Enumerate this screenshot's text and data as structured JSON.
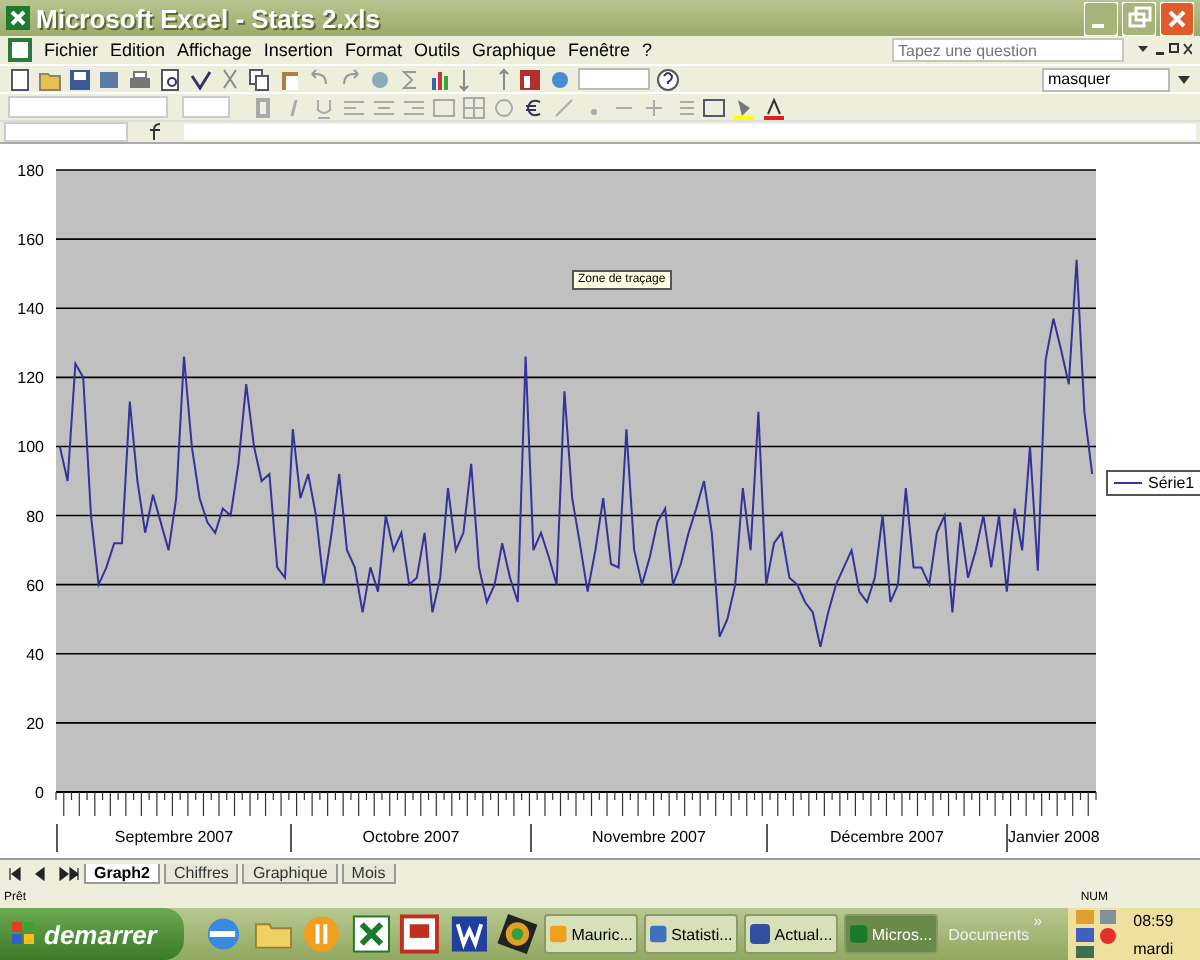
{
  "window": {
    "title": "Microsoft Excel - Stats 2.xls"
  },
  "menu": [
    "Fichier",
    "Edition",
    "Affichage",
    "Insertion",
    "Format",
    "Outils",
    "Graphique",
    "Fenêtre",
    "?"
  ],
  "question_box": {
    "placeholder": "Tapez une question"
  },
  "combo": {
    "value": "masquer"
  },
  "chart": {
    "tooltip": "Zone de traçage",
    "month_labels": [
      "Septembre 2007",
      "Octobre 2007",
      "Novembre 2007",
      "Décembre 2007",
      "Janvier 2008"
    ],
    "chart_data": {
      "type": "line",
      "grid": true,
      "ylim": [
        0,
        180
      ],
      "yticks": [
        0,
        20,
        40,
        60,
        80,
        100,
        120,
        140,
        160,
        180
      ],
      "series": [
        {
          "name": "Série1",
          "color": "#333399",
          "values": [
            100,
            90,
            124,
            120,
            80,
            60,
            65,
            72,
            72,
            113,
            90,
            75,
            86,
            78,
            70,
            85,
            126,
            100,
            85,
            78,
            75,
            82,
            80,
            95,
            118,
            100,
            90,
            92,
            65,
            62,
            105,
            85,
            92,
            80,
            60,
            75,
            92,
            70,
            65,
            52,
            65,
            58,
            80,
            70,
            75,
            60,
            62,
            75,
            52,
            62,
            88,
            70,
            75,
            95,
            65,
            55,
            60,
            72,
            62,
            55,
            126,
            70,
            75,
            68,
            60,
            116,
            85,
            72,
            58,
            70,
            85,
            66,
            65,
            105,
            70,
            60,
            68,
            78,
            82,
            60,
            66,
            75,
            82,
            90,
            75,
            45,
            50,
            60,
            88,
            70,
            110,
            60,
            72,
            75,
            62,
            60,
            55,
            52,
            42,
            52,
            60,
            65,
            70,
            58,
            55,
            62,
            80,
            55,
            60,
            88,
            65,
            65,
            60,
            75,
            80,
            52,
            78,
            62,
            70,
            80,
            65,
            80,
            58,
            82,
            70,
            100,
            64,
            125,
            137,
            128,
            118,
            154,
            110,
            92
          ]
        }
      ]
    }
  },
  "sheet_tabs": [
    {
      "label": "Graph2",
      "selected": true
    },
    {
      "label": "Chiffres",
      "selected": false
    },
    {
      "label": "Graphique",
      "selected": false
    },
    {
      "label": "Mois",
      "selected": false
    }
  ],
  "status_bar": {
    "left": "Prêt",
    "right": "NUM"
  },
  "taskbar": {
    "start": "demarrer",
    "tasks": [
      {
        "label": "Mauric...",
        "selected": false
      },
      {
        "label": "Statisti...",
        "selected": false
      },
      {
        "label": "Actual...",
        "selected": false
      },
      {
        "label": "Micros...",
        "selected": true
      }
    ],
    "documents": "Documents",
    "chevron": "»",
    "time": "08:59",
    "day": "mardi"
  }
}
